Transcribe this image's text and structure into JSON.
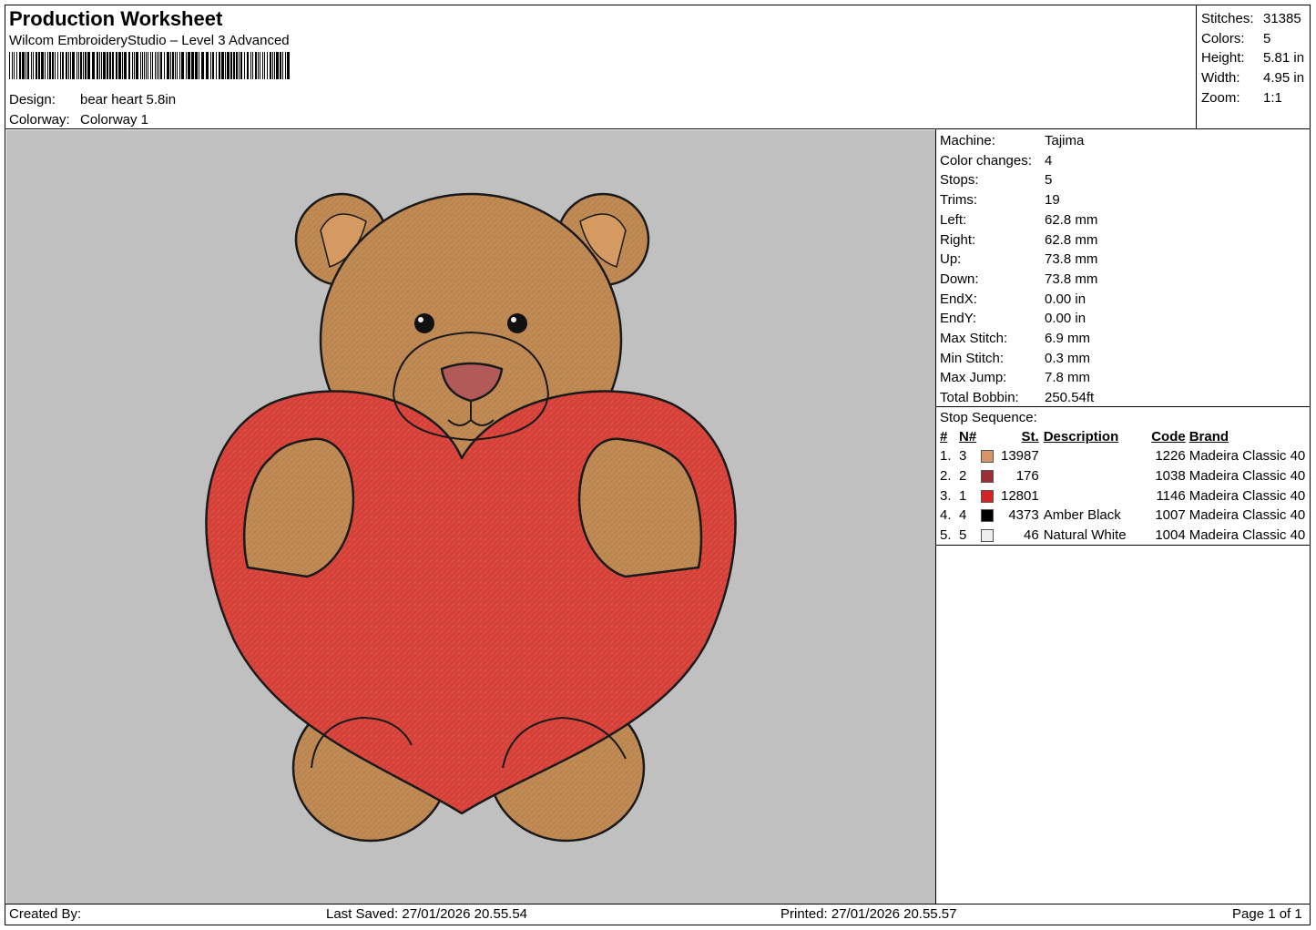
{
  "header": {
    "title": "Production Worksheet",
    "software": "Wilcom EmbroideryStudio – Level 3 Advanced",
    "design_label": "Design:",
    "design_value": "bear heart 5.8in",
    "colorway_label": "Colorway:",
    "colorway_value": "Colorway 1"
  },
  "summary": [
    {
      "label": "Stitches:",
      "value": "31385"
    },
    {
      "label": "Colors:",
      "value": "5"
    },
    {
      "label": "Height:",
      "value": "5.81 in"
    },
    {
      "label": "Width:",
      "value": "4.95 in"
    },
    {
      "label": "Zoom:",
      "value": "1:1"
    }
  ],
  "machine_params": [
    {
      "label": "Machine:",
      "value": "Tajima"
    },
    {
      "label": "Color changes:",
      "value": "4"
    },
    {
      "label": "Stops:",
      "value": "5"
    },
    {
      "label": "Trims:",
      "value": "19"
    },
    {
      "label": "Left:",
      "value": "62.8 mm"
    },
    {
      "label": "Right:",
      "value": "62.8 mm"
    },
    {
      "label": "Up:",
      "value": "73.8 mm"
    },
    {
      "label": "Down:",
      "value": "73.8 mm"
    },
    {
      "label": "EndX:",
      "value": "0.00 in"
    },
    {
      "label": "EndY:",
      "value": "0.00 in"
    },
    {
      "label": "Max Stitch:",
      "value": "6.9 mm"
    },
    {
      "label": "Min Stitch:",
      "value": "0.3 mm"
    },
    {
      "label": "Max Jump:",
      "value": "7.8 mm"
    },
    {
      "label": "Total Bobbin:",
      "value": "250.54ft"
    }
  ],
  "stop_sequence": {
    "caption": "Stop Sequence:",
    "headers": {
      "no": "#",
      "n": "N#",
      "st": "St.",
      "desc": "Description",
      "code": "Code",
      "brand": "Brand"
    },
    "rows": [
      {
        "no": "1.",
        "n": "3",
        "color": "#d9956a",
        "st": "13987",
        "desc": "",
        "code": "1226",
        "brand": "Madeira Classic 40"
      },
      {
        "no": "2.",
        "n": "2",
        "color": "#9a2f35",
        "st": "176",
        "desc": "",
        "code": "1038",
        "brand": "Madeira Classic 40"
      },
      {
        "no": "3.",
        "n": "1",
        "color": "#d42323",
        "st": "12801",
        "desc": "",
        "code": "1146",
        "brand": "Madeira Classic 40"
      },
      {
        "no": "4.",
        "n": "4",
        "color": "#000000",
        "st": "4373",
        "desc": "Amber Black",
        "code": "1007",
        "brand": "Madeira Classic 40"
      },
      {
        "no": "5.",
        "n": "5",
        "color": "#eeeeee",
        "st": "46",
        "desc": "Natural White",
        "code": "1004",
        "brand": "Madeira Classic 40"
      }
    ]
  },
  "footer": {
    "created_by": "Created By:",
    "last_saved": "Last Saved: 27/01/2026 20.55.54",
    "printed": "Printed: 27/01/2026 20.55.57",
    "page": "Page 1 of 1"
  },
  "colors": {
    "canvas_bg": "#c0c0c0",
    "bear_fur": "#c08a55",
    "heart": "#d9453c",
    "nose": "#b25a58",
    "outline": "#1a1a1a"
  }
}
